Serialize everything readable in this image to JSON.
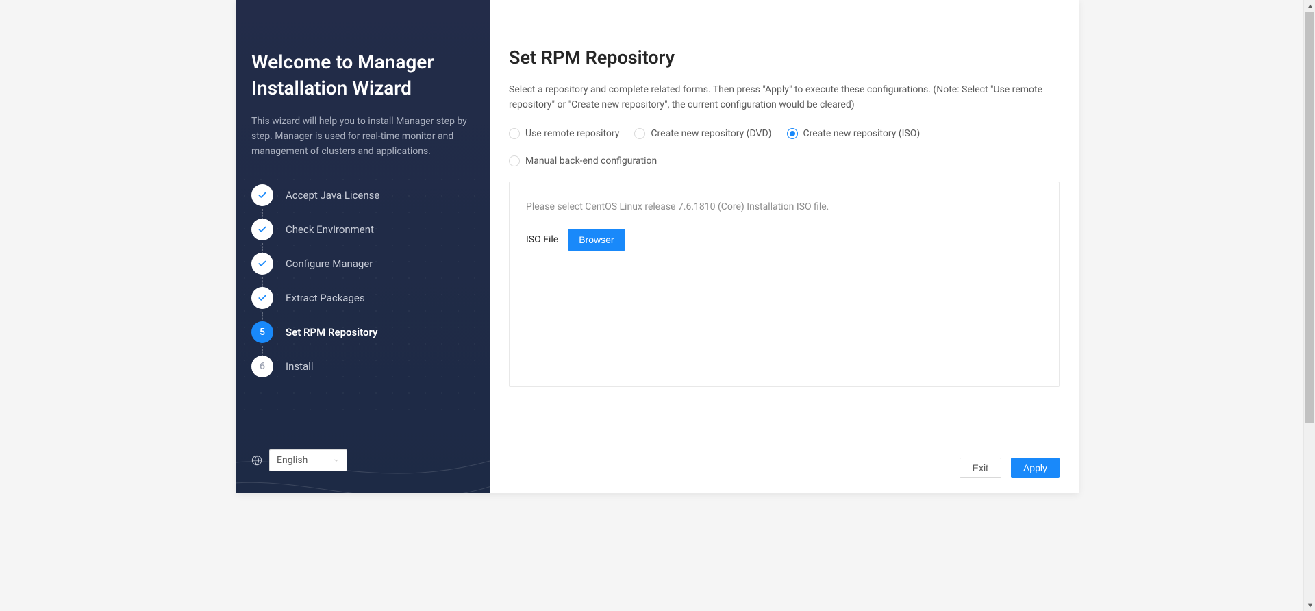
{
  "sidebar": {
    "title": "Welcome to Manager Installation Wizard",
    "description": "This wizard will help you to install Manager step by step. Manager is used for real-time monitor and management of clusters and applications.",
    "steps": [
      {
        "label": "Accept Java License",
        "state": "done"
      },
      {
        "label": "Check Environment",
        "state": "done"
      },
      {
        "label": "Configure Manager",
        "state": "done"
      },
      {
        "label": "Extract Packages",
        "state": "done"
      },
      {
        "label": "Set RPM Repository",
        "state": "current",
        "num": "5"
      },
      {
        "label": "Install",
        "state": "pending",
        "num": "6"
      }
    ],
    "language": {
      "selected": "English"
    }
  },
  "main": {
    "heading": "Set RPM Repository",
    "description": "Select a repository and complete related forms. Then press \"Apply\" to execute these configurations.    (Note: Select \"Use remote repository\" or \"Create new repository\", the current configuration would be cleared)",
    "radio_options": {
      "remote": "Use remote repository",
      "dvd": "Create new repository (DVD)",
      "iso": "Create new repository (ISO)",
      "manual": "Manual back-end configuration"
    },
    "selected_option": "iso",
    "form": {
      "hint": "Please select CentOS Linux release 7.6.1810 (Core) Installation ISO file.",
      "iso_label": "ISO File",
      "browse_label": "Browser"
    },
    "footer": {
      "exit": "Exit",
      "apply": "Apply"
    }
  }
}
